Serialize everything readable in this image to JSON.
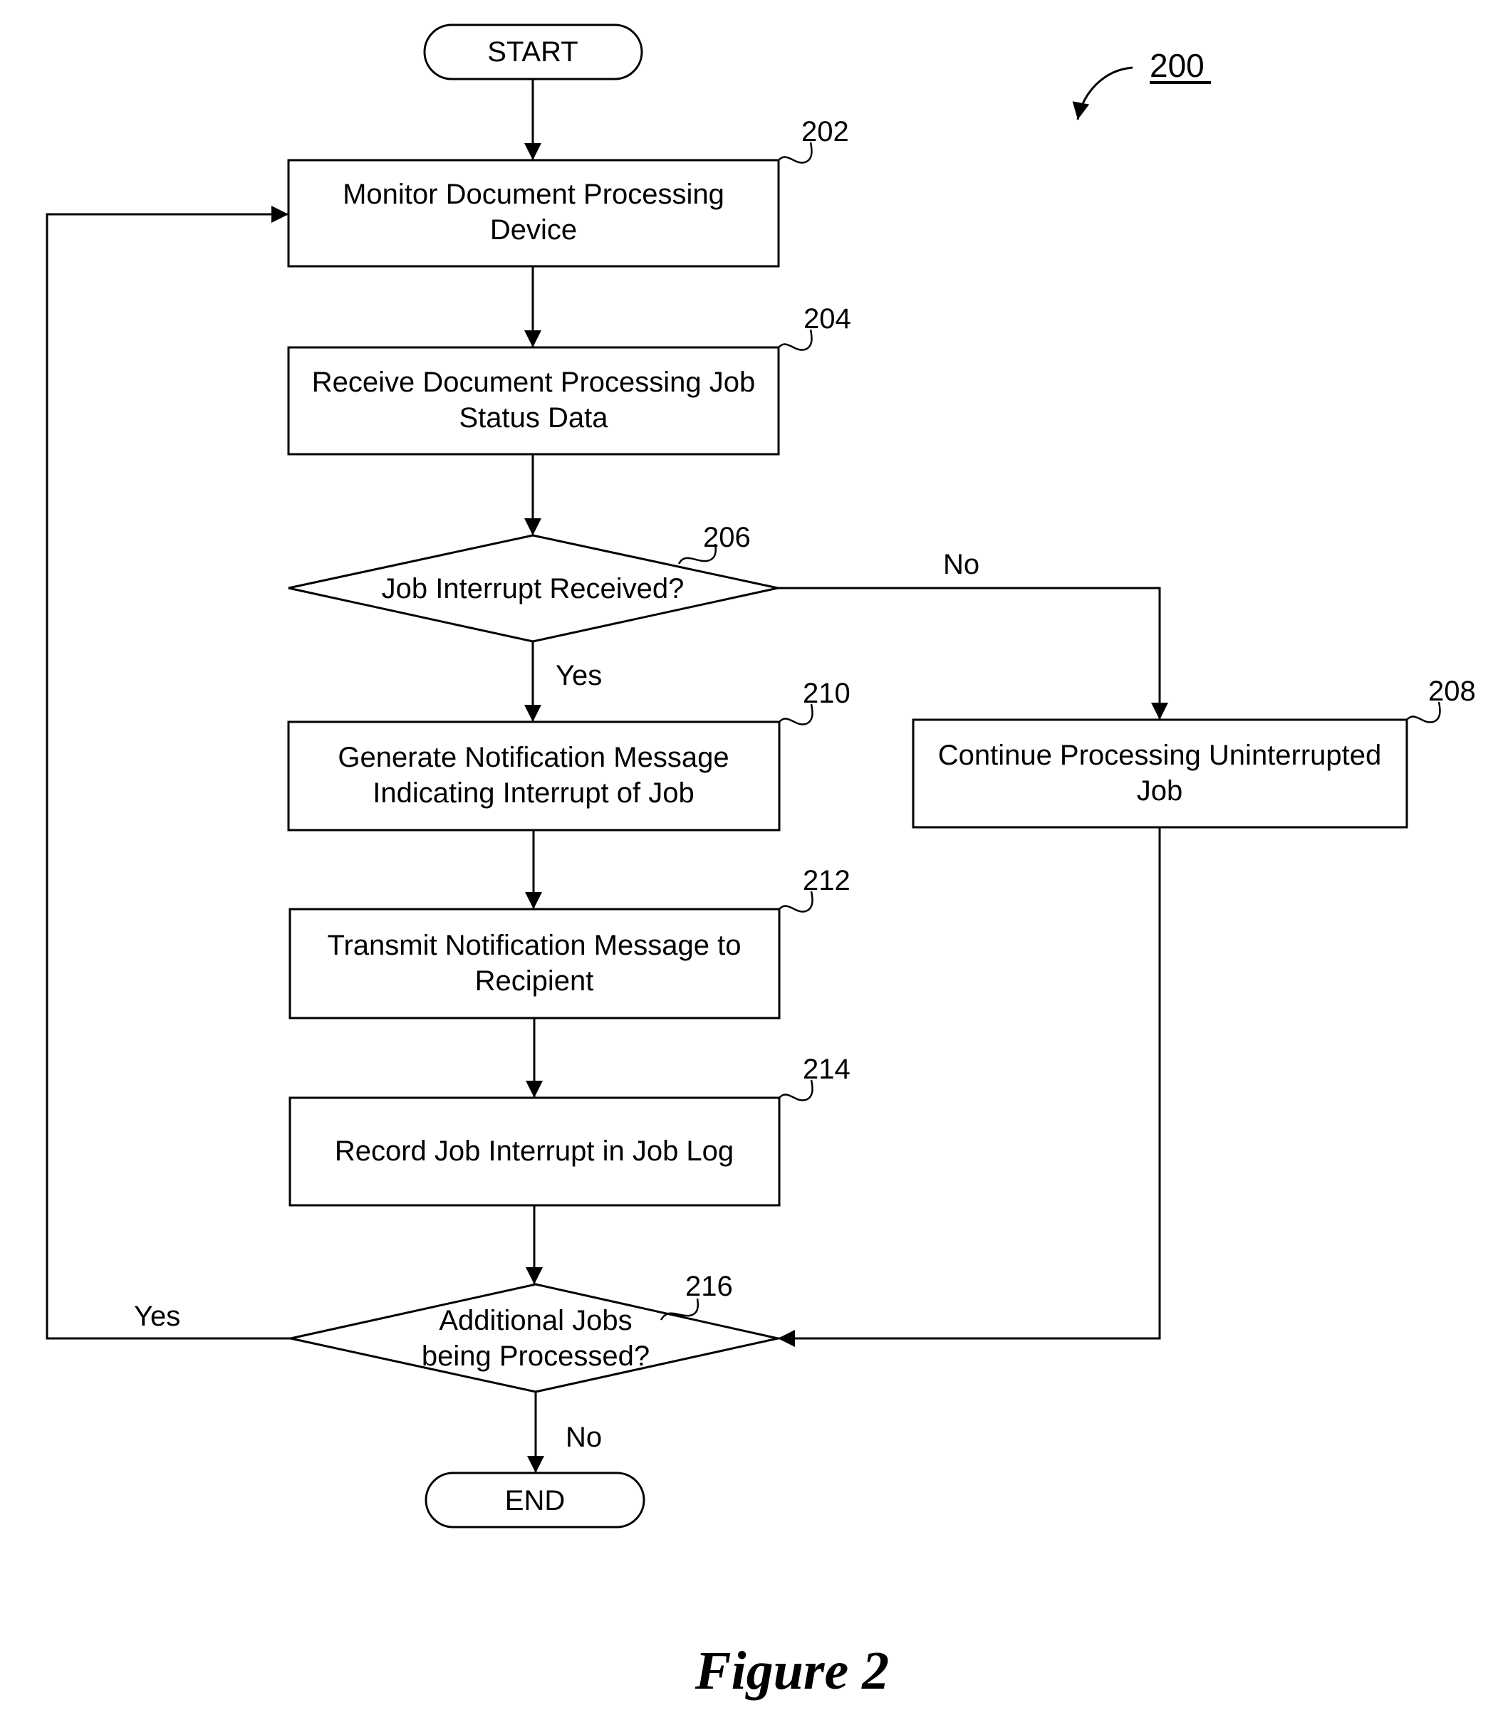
{
  "figure": {
    "number_label": "200",
    "caption": "Figure 2"
  },
  "nodes": {
    "start": {
      "text": "START"
    },
    "n202": {
      "ref": "202",
      "lines": [
        "Monitor Document Processing",
        "Device"
      ]
    },
    "n204": {
      "ref": "204",
      "lines": [
        "Receive Document Processing Job",
        "Status Data"
      ]
    },
    "n206": {
      "ref": "206",
      "lines": [
        "Job Interrupt Received?"
      ]
    },
    "n208": {
      "ref": "208",
      "lines": [
        "Continue Processing Uninterrupted",
        "Job"
      ]
    },
    "n210": {
      "ref": "210",
      "lines": [
        "Generate Notification Message",
        "Indicating Interrupt of Job"
      ]
    },
    "n212": {
      "ref": "212",
      "lines": [
        "Transmit Notification Message to",
        "Recipient"
      ]
    },
    "n214": {
      "ref": "214",
      "lines": [
        "Record Job Interrupt in Job Log"
      ]
    },
    "n216": {
      "ref": "216",
      "lines": [
        "Additional Jobs",
        "being Processed?"
      ]
    },
    "end": {
      "text": "END"
    }
  },
  "edges": {
    "e206_no": "No",
    "e206_yes": "Yes",
    "e216_yes": "Yes",
    "e216_no": "No"
  }
}
